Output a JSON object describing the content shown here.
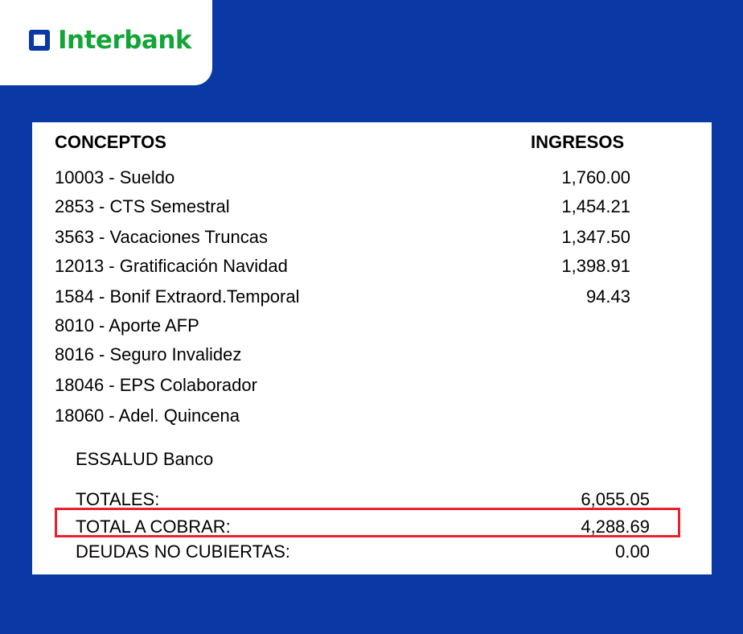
{
  "brand": {
    "name": "Interbank",
    "colors": {
      "background": "#0a38a5",
      "logo_text": "#13a538",
      "highlight": "#e8212f"
    }
  },
  "table": {
    "header_concept": "CONCEPTOS",
    "header_income": "INGRESOS",
    "rows": [
      {
        "concept": "10003 - Sueldo",
        "value": "1,760.00"
      },
      {
        "concept": "2853 - CTS Semestral",
        "value": "1,454.21"
      },
      {
        "concept": "3563 - Vacaciones Truncas",
        "value": "1,347.50"
      },
      {
        "concept": "12013 - Gratificación Navidad",
        "value": "1,398.91"
      },
      {
        "concept": "1584 - Bonif Extraord.Temporal",
        "value": "94.43"
      },
      {
        "concept": "8010 - Aporte AFP",
        "value": ""
      },
      {
        "concept": "8016 - Seguro Invalidez",
        "value": ""
      },
      {
        "concept": "18046 - EPS Colaborador",
        "value": ""
      },
      {
        "concept": "18060 - Adel. Quincena",
        "value": ""
      }
    ],
    "essalud": "ESSALUD Banco"
  },
  "summary": {
    "totales_label": "TOTALES:",
    "totales_value": "6,055.05",
    "total_cobrar_label": "TOTAL A COBRAR:",
    "total_cobrar_value": "4,288.69",
    "deudas_label": "DEUDAS NO CUBIERTAS:",
    "deudas_value": "0.00"
  }
}
